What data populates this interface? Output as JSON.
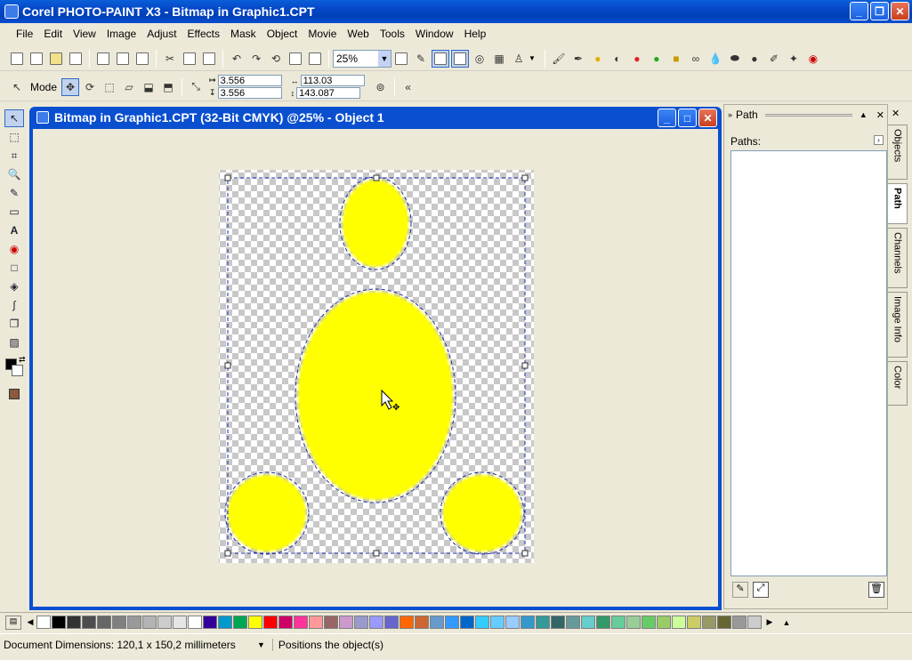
{
  "app": {
    "title": "Corel PHOTO-PAINT X3 - Bitmap in Graphic1.CPT"
  },
  "menu": [
    "File",
    "Edit",
    "View",
    "Image",
    "Adjust",
    "Effects",
    "Mask",
    "Object",
    "Movie",
    "Web",
    "Tools",
    "Window",
    "Help"
  ],
  "toolbar": {
    "zoom_value": "25%"
  },
  "property_bar": {
    "mode_label": "Mode",
    "pos_x": "3.556",
    "pos_y": "3.556",
    "width": "113.03",
    "height": "143.087"
  },
  "document": {
    "title": "Bitmap in Graphic1.CPT (32-Bit CMYK) @25% - Object 1"
  },
  "panel": {
    "title": "Path",
    "paths_label": "Paths:",
    "tabs": [
      "Objects",
      "Path",
      "Channels",
      "Image Info",
      "Color"
    ]
  },
  "palette": {
    "colors": [
      "#000000",
      "#333333",
      "#4d4d4d",
      "#666666",
      "#808080",
      "#999999",
      "#b3b3b3",
      "#cccccc",
      "#e6e6e6",
      "#ffffff",
      "#330099",
      "#0099cc",
      "#00a651",
      "#ffff00",
      "#ff0000",
      "#cc0066",
      "#ff3399",
      "#ff9999",
      "#996666",
      "#cc99cc",
      "#9999cc",
      "#9999ff",
      "#6666cc",
      "#ff6600",
      "#cc6633",
      "#6699cc",
      "#3399ff",
      "#0066cc",
      "#33ccff",
      "#66ccff",
      "#99ccff",
      "#3399cc",
      "#339999",
      "#336666",
      "#669999",
      "#66cccc",
      "#339966",
      "#66cc99",
      "#99cc99",
      "#66cc66",
      "#99cc66",
      "#ccff99",
      "#cccc66",
      "#999966",
      "#666633",
      "#999999",
      "#cccccc"
    ],
    "accent_yellow": "#ffff00"
  },
  "status": {
    "dimensions": "Document Dimensions: 120,1 x 150,2 millimeters",
    "message": "Positions the object(s)"
  }
}
